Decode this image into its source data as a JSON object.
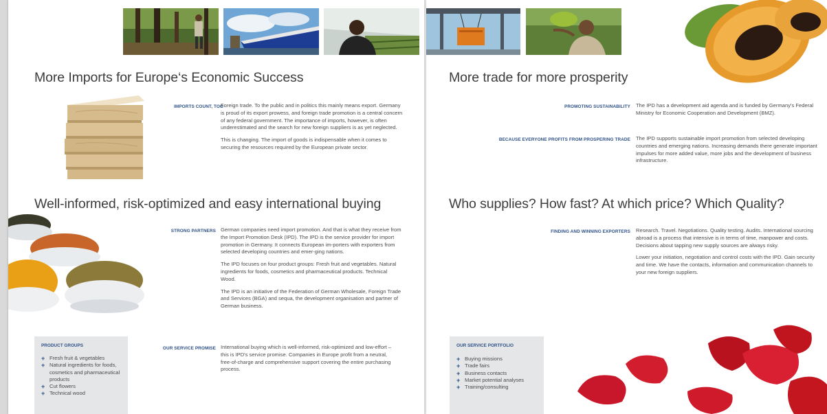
{
  "left_page": {
    "heading_1": "More Imports for Europe‘s Economic Success",
    "imports_count": {
      "label": "IMPORTS COUNT, TOO",
      "paragraphs": [
        "Foreign trade. To the public and in politics this mainly means export. Germany is proud of its export prowess, and foreign trade promotion is a central concern of any federal government. The importance of imports, however, is often underestimated and the search for new foreign suppliers is as yet neglected.",
        "This is changing. The import of goods is indispensable when it comes to securing the resources required by the European private sector."
      ]
    },
    "heading_2": "Well-informed, risk-optimized and easy international buying",
    "strong_partners": {
      "label": "STRONG PARTNERS",
      "paragraphs": [
        "German companies need import promotion. And that is what they receive from the Import Promotion Desk (IPD). The IPD is the service provider for import promotion in Germany. It connects European im-porters with exporters from selected developing countries and emer-ging nations.",
        "The IPD focuses on four product groups: Fresh fruit and vegetables. Natural ingredients for foods, cosmetics and pharmaceutical products. Technical Wood.",
        "The IPD is an initiative of the Federation of German Wholesale, Foreign Trade and Services (BGA) and sequa, the development organisation and partner of German business."
      ]
    },
    "service_promise": {
      "label": "OUR SERVICE PROMISE",
      "paragraphs": [
        "International buying which is well-informed, risk-optimized and low-effort – this is IPD's service promise. Companies in Europe profit from a neutral, free-of-charge and comprehensive support covering the entire purchasing process."
      ]
    },
    "product_groups": {
      "title": "PRODUCT GROUPS",
      "items": [
        "Fresh fruit & vegetables",
        "Natural ingredients for foods, cosmetics and pharmaceutical products",
        "Cut flowers",
        "Technical wood"
      ]
    }
  },
  "right_page": {
    "heading_1": "More trade for more prosperity",
    "promoting": {
      "label": "PROMOTING SUSTAINABILITY",
      "paragraphs": [
        "The IPD has a development aid agenda and is funded by Germany's Federal Ministry for Economic Cooperation and Development (BMZ)."
      ]
    },
    "everyone_profits": {
      "label": "BECAUSE EVERYONE PROFITS FROM PROSPERING TRADE",
      "paragraphs": [
        "The IPD supports sustainable import promotion from selected developing countries and emerging nations. Increasing demands there generate important impulses for more added value, more jobs and the development of business infrastructure."
      ]
    },
    "heading_2": "Who supplies? How fast? At which price? Which Quality?",
    "finding": {
      "label": "FINDING AND WINNING EXPORTERS",
      "paragraphs": [
        "Research. Travel. Negotiations. Quality testing. Audits. International sourcing abroad is a process that intensive is in terms of time, manpower and costs. Decisions about tapping new supply sources are always risky.",
        "Lower your initiation, negotiation and control costs with the IPD. Gain security and time. We have the contacts, information and communication channels to your new foreign suppliers."
      ]
    },
    "service_portfolio": {
      "title": "OUR SERVICE PORTFOLIO",
      "items": [
        "Buying missions",
        "Trade fairs",
        "Business contacts",
        "Market potential analyses",
        "Training/consulting"
      ]
    }
  },
  "bullet_symbol": "+",
  "colors": {
    "accent": "#2d4f86",
    "text": "#4a4a4a",
    "heading": "#3c3c3c",
    "box": "#e5e6e8"
  },
  "images": [
    "forest-worker-photo",
    "cargo-ship-photo",
    "greenhouse-farmer-photo",
    "container-crane-photo",
    "banana-farmer-photo",
    "papaya-fruit-image",
    "wood-planks-image",
    "spice-bowls-image",
    "rose-petals-image"
  ]
}
